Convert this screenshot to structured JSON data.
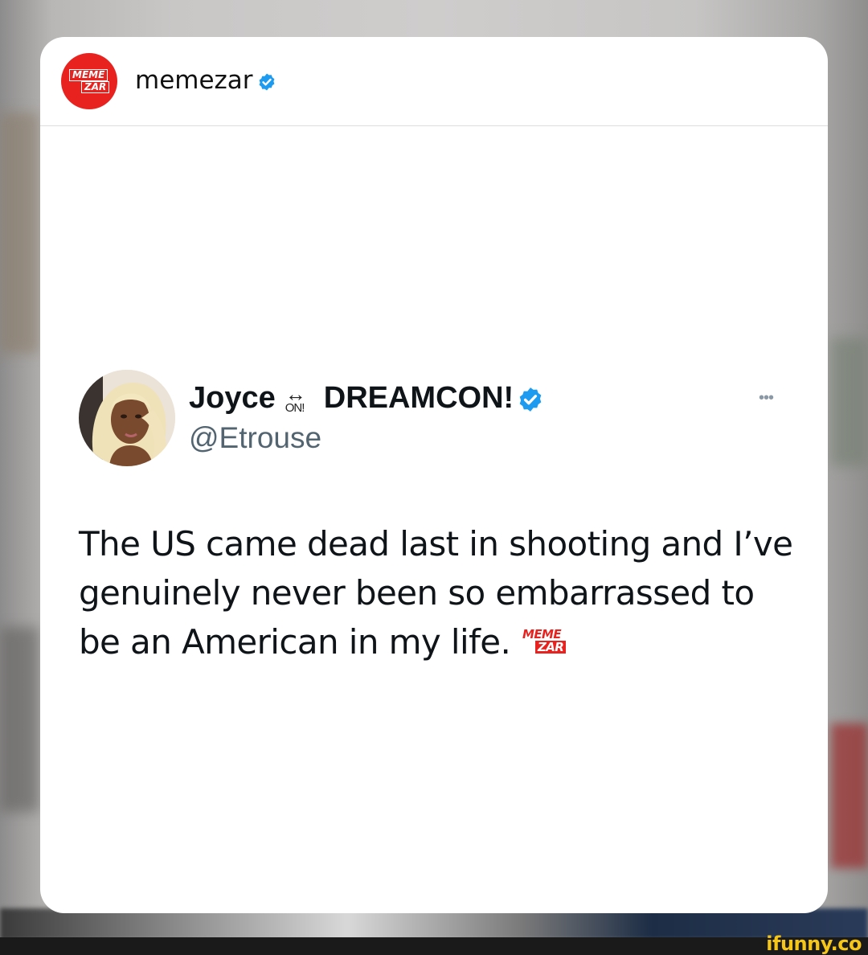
{
  "post": {
    "account_name": "memezar",
    "logo_line1": "MEME",
    "logo_line2": "ZAR"
  },
  "tweet": {
    "display_name": "Joyce",
    "on_icon_label": "ON!",
    "display_name_suffix": "DREAMCON!",
    "handle": "@Etrouse",
    "more_label": "•••",
    "text": "The US came dead last in shooting and I’ve genuinely never been so embarrassed to be an American in my life.",
    "watermark_line1": "MEME",
    "watermark_line2": "ZAR"
  },
  "footer": {
    "site_logo": "ifunny.co"
  },
  "colors": {
    "brand_red": "#e8231f",
    "verified_blue": "#1d9bf0",
    "handle_gray": "#536471"
  }
}
